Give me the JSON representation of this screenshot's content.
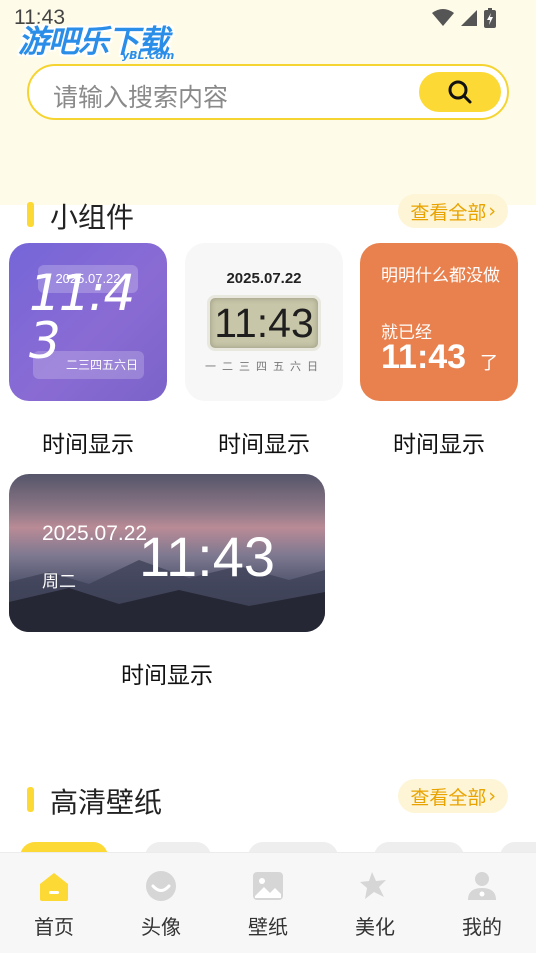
{
  "status_bar": {
    "time": "11:43"
  },
  "watermark": {
    "main": "游吧乐下载",
    "sub": "yBL.com"
  },
  "search": {
    "placeholder": "请输入搜索内容"
  },
  "widgets_section": {
    "title": "小组件",
    "see_all": "查看全部"
  },
  "widgets": [
    {
      "label": "时间显示",
      "date": "2025.07.22",
      "time": "11:43",
      "weekdays": "二三四五六日"
    },
    {
      "label": "时间显示",
      "date": "2025.07.22",
      "time": "11:43",
      "weekdays": "一二三四五六日"
    },
    {
      "label": "时间显示",
      "text1": "明明什么都没做",
      "text2": "就已经",
      "time": "11:43",
      "tail": "了"
    },
    {
      "label": "时间显示",
      "date": "2025.07.22",
      "weekday": "周二",
      "time": "11:43"
    }
  ],
  "wallpaper_section": {
    "title": "高清壁纸",
    "see_all": "查看全部"
  },
  "nav": {
    "items": [
      {
        "label": "首页",
        "icon": "home-icon",
        "active": true
      },
      {
        "label": "头像",
        "icon": "avatar-icon",
        "active": false
      },
      {
        "label": "壁纸",
        "icon": "wallpaper-icon",
        "active": false
      },
      {
        "label": "美化",
        "icon": "beautify-icon",
        "active": false
      },
      {
        "label": "我的",
        "icon": "profile-icon",
        "active": false
      }
    ]
  },
  "colors": {
    "accent": "#fcd934",
    "see_all_text": "#e9a300",
    "active_icon": "#fcd934",
    "inactive_icon": "#d6d6d6"
  }
}
